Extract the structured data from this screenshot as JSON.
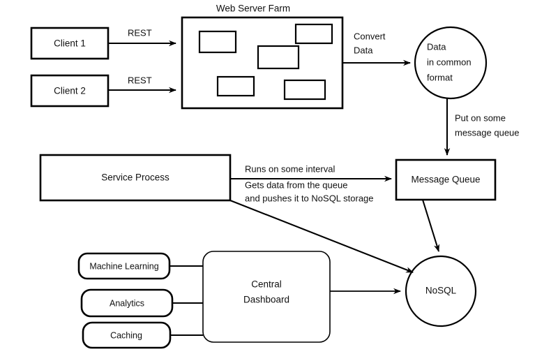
{
  "diagram": {
    "title": "Data pipeline architecture diagram",
    "colors": {
      "background": "#ffffff",
      "stroke": "#000000",
      "text": "#111111"
    },
    "nodes": {
      "client1": {
        "label": "Client 1",
        "shape": "rectangle"
      },
      "client2": {
        "label": "Client 2",
        "shape": "rectangle"
      },
      "web_server_farm": {
        "title": "Web Server Farm",
        "shape": "rectangle-container",
        "server_count": 5,
        "servers": [
          {
            "label": ""
          },
          {
            "label": ""
          },
          {
            "label": ""
          },
          {
            "label": ""
          },
          {
            "label": ""
          }
        ]
      },
      "data_common_format": {
        "shape": "circle",
        "lines": [
          "Data",
          "in common",
          "format"
        ]
      },
      "message_queue": {
        "label": "Message Queue",
        "shape": "rectangle"
      },
      "service_process": {
        "label": "Service Process",
        "shape": "rectangle"
      },
      "nosql": {
        "label": "NoSQL",
        "shape": "circle"
      },
      "central_dashboard": {
        "shape": "rounded-rectangle",
        "lines": [
          "Central",
          "Dashboard"
        ]
      },
      "machine_learning": {
        "label": "Machine Learning",
        "shape": "rounded-rectangle"
      },
      "analytics": {
        "label": "Analytics",
        "shape": "rounded-rectangle"
      },
      "caching": {
        "label": "Caching",
        "shape": "rounded-rectangle"
      }
    },
    "edges": {
      "client1_to_farm": {
        "label": "REST"
      },
      "client2_to_farm": {
        "label": "REST"
      },
      "farm_to_data": {
        "lines": [
          "Convert",
          "Data"
        ]
      },
      "data_to_queue": {
        "lines": [
          "Put on some",
          "message queue"
        ]
      },
      "service_to_queue": {
        "lines": [
          "Runs on some interval",
          "Gets data from the queue",
          "and pushes it to NoSQL storage"
        ]
      },
      "service_to_nosql": {
        "label": ""
      },
      "queue_to_nosql": {
        "label": ""
      },
      "dashboard_to_nosql": {
        "label": ""
      },
      "ml_to_dashboard": {
        "label": ""
      },
      "analytics_to_dashboard": {
        "label": ""
      },
      "caching_to_dashboard": {
        "label": ""
      }
    }
  }
}
